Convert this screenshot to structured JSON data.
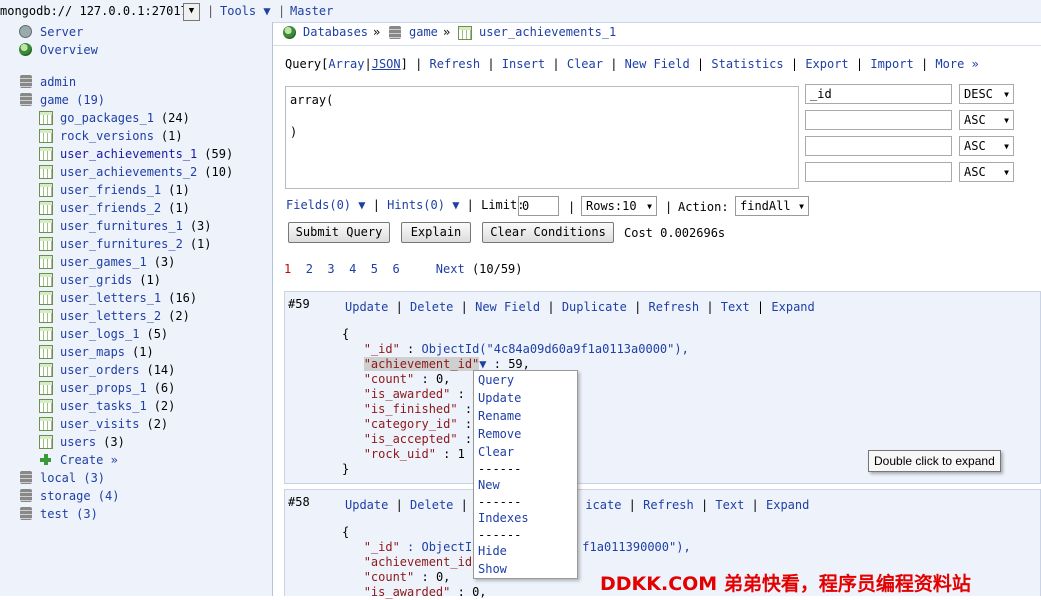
{
  "topbar": {
    "connection": "mongodb:// 127.0.0.1:27017",
    "tools": "Tools ▼",
    "master": "Master"
  },
  "sidebar": {
    "server": "Server",
    "overview": "Overview",
    "databases": [
      {
        "name": "admin"
      },
      {
        "name": "game (19)"
      }
    ],
    "collections": [
      {
        "name": "go_packages_1",
        "count": "(24)"
      },
      {
        "name": "rock_versions",
        "count": "(1)"
      },
      {
        "name": "user_achievements_1",
        "count": "(59)"
      },
      {
        "name": "user_achievements_2",
        "count": "(10)"
      },
      {
        "name": "user_friends_1",
        "count": "(1)"
      },
      {
        "name": "user_friends_2",
        "count": "(1)"
      },
      {
        "name": "user_furnitures_1",
        "count": "(3)"
      },
      {
        "name": "user_furnitures_2",
        "count": "(1)"
      },
      {
        "name": "user_games_1",
        "count": "(3)"
      },
      {
        "name": "user_grids",
        "count": "(1)"
      },
      {
        "name": "user_letters_1",
        "count": "(16)"
      },
      {
        "name": "user_letters_2",
        "count": "(2)"
      },
      {
        "name": "user_logs_1",
        "count": "(5)"
      },
      {
        "name": "user_maps",
        "count": "(1)"
      },
      {
        "name": "user_orders",
        "count": "(14)"
      },
      {
        "name": "user_props_1",
        "count": "(6)"
      },
      {
        "name": "user_tasks_1",
        "count": "(2)"
      },
      {
        "name": "user_visits",
        "count": "(2)"
      },
      {
        "name": "users",
        "count": "(3)"
      }
    ],
    "create": "Create »",
    "other_dbs": [
      {
        "name": "local (3)"
      },
      {
        "name": "storage (4)"
      },
      {
        "name": "test (3)"
      }
    ]
  },
  "breadcrumb": {
    "databases": "Databases",
    "sep": "»",
    "db": "game",
    "collection": "user_achievements_1"
  },
  "actions": {
    "query": "Query",
    "array": "Array",
    "json": "JSON",
    "refresh": "Refresh",
    "insert": "Insert",
    "clear": "Clear",
    "new_field": "New Field",
    "statistics": "Statistics",
    "export": "Export",
    "import": "Import",
    "more": "More »"
  },
  "query": {
    "line1": "array(",
    "line2": ")",
    "sort_fields": [
      "_id",
      "",
      "",
      ""
    ],
    "sort_dirs": [
      "DESC",
      "ASC",
      "ASC",
      "ASC"
    ],
    "fields": "Fields(0) ▼",
    "hints": "Hints(0) ▼",
    "limit_label": "Limit:",
    "limit_value": "0",
    "rows": "Rows:10",
    "action_label": "Action:",
    "action_value": "findAll",
    "submit": "Submit Query",
    "explain": "Explain",
    "clear_conditions": "Clear Conditions",
    "cost": "Cost 0.002696s"
  },
  "pager": {
    "current": "1",
    "pages": [
      "2",
      "3",
      "4",
      "5",
      "6"
    ],
    "next": "Next",
    "count": "(10/59)"
  },
  "doc_actions": {
    "update": "Update",
    "delete": "Delete",
    "new_field": "New Field",
    "duplicate": "Duplicate",
    "refresh": "Refresh",
    "text": "Text",
    "expand": "Expand",
    "partial": "I",
    "partial_dup": "icate"
  },
  "docs": [
    {
      "num": "#59",
      "lines": {
        "open": "{",
        "id_key": "\"_id\"",
        "id_val_fn": "ObjectId(",
        "id_val": "\"4c84a09d60a9f1a0113a0000\"",
        "id_end": "),",
        "ach_key": "\"achievement_id\"",
        "ach_arrow": "▼",
        "ach_val": " : 59,",
        "count_key": "\"count\"",
        "count_val": " : 0,",
        "awarded_key": "\"is_awarded\"",
        "awarded_val": " : 0",
        "finished_key": "\"is_finished\"",
        "finished_val": " :",
        "category_key": "\"category_id\"",
        "category_val": " :",
        "accepted_key": "\"is_accepted\"",
        "accepted_val": " :",
        "rock_key": "\"rock_uid\"",
        "rock_val": " : 1",
        "close": "}"
      }
    },
    {
      "num": "#58",
      "lines": {
        "open": "{",
        "id_key": "\"_id\"",
        "id_val_fn": " : ObjectIc",
        "id_val": "f1a011390000\"",
        "id_end": "),",
        "ach_key": "\"achievement_id\"",
        "count_key": "\"count\"",
        "count_val": " : 0,",
        "awarded_key": "\"is_awarded\"",
        "awarded_val": " : 0,"
      }
    }
  ],
  "context_menu": {
    "items": [
      "Query",
      "Update",
      "Rename",
      "Remove",
      "Clear"
    ],
    "sep": "------",
    "new": "New",
    "indexes": "Indexes",
    "hide": "Hide",
    "show": "Show"
  },
  "tooltip": "Double click to expand",
  "watermark": "DDKK.COM 弟弟快看，程序员编程资料站"
}
